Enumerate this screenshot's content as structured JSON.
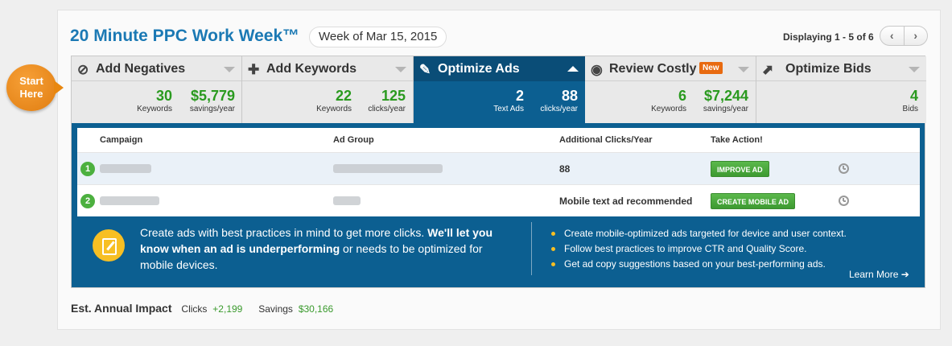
{
  "header": {
    "title": "20 Minute PPC Work Week™",
    "week": "Week of Mar 15, 2015",
    "displaying": "Displaying 1 - 5 of 6",
    "start_badge_line1": "Start",
    "start_badge_line2": "Here"
  },
  "tabs": [
    {
      "label": "Add Negatives",
      "metrics": [
        {
          "num": "30",
          "lbl": "Keywords"
        },
        {
          "num": "$5,779",
          "lbl": "savings/year"
        }
      ]
    },
    {
      "label": "Add Keywords",
      "metrics": [
        {
          "num": "22",
          "lbl": "Keywords"
        },
        {
          "num": "125",
          "lbl": "clicks/year"
        }
      ]
    },
    {
      "label": "Optimize Ads",
      "metrics": [
        {
          "num": "2",
          "lbl": "Text Ads"
        },
        {
          "num": "88",
          "lbl": "clicks/year"
        }
      ]
    },
    {
      "label": "Review Costly",
      "badge": "New",
      "metrics": [
        {
          "num": "6",
          "lbl": "Keywords"
        },
        {
          "num": "$7,244",
          "lbl": "savings/year"
        }
      ]
    },
    {
      "label": "Optimize Bids",
      "metrics": [
        {
          "num": "4",
          "lbl": "Bids"
        }
      ]
    }
  ],
  "table": {
    "headers": {
      "campaign": "Campaign",
      "ad_group": "Ad Group",
      "clicks": "Additional Clicks/Year",
      "action": "Take Action!"
    },
    "rows": [
      {
        "num": "1",
        "clicks": "88",
        "action": "IMPROVE AD"
      },
      {
        "num": "2",
        "clicks": "Mobile text ad recommended",
        "action": "CREATE MOBILE AD"
      }
    ]
  },
  "info": {
    "text_1": "Create ads with best practices in mind to get more clicks. ",
    "text_bold": "We'll let you know when an ad is underperforming",
    "text_2": " or needs to be optimized for mobile devices.",
    "bullets": [
      "Create mobile-optimized ads targeted for device and user context.",
      "Follow best practices to improve CTR and Quality Score.",
      "Get ad copy suggestions based on your best-performing ads."
    ],
    "learn_more": "Learn More ➔"
  },
  "impact": {
    "label": "Est. Annual Impact",
    "clicks_label": "Clicks",
    "clicks_value": "+2,199",
    "savings_label": "Savings",
    "savings_value": "$30,166"
  },
  "colors": {
    "brand_blue": "#0c5f91",
    "title_blue": "#1b79b4",
    "green": "#2a9a1f",
    "orange": "#e8870f"
  },
  "icons": [
    "ban-icon",
    "plus-icon",
    "edit-icon",
    "eye-icon",
    "trend-icon",
    "clock-icon",
    "chevron-left-icon",
    "chevron-right-icon"
  ]
}
